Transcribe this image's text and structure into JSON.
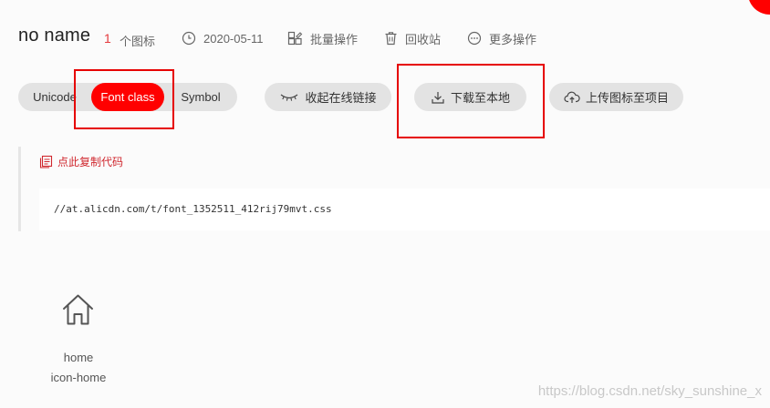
{
  "header": {
    "project_name": "no name",
    "icon_count": "1",
    "icon_count_label": "个图标",
    "date": "2020-05-11",
    "batch_label": "批量操作",
    "recycle_label": "回收站",
    "more_label": "更多操作"
  },
  "tabs": {
    "unicode": "Unicode",
    "font_class": "Font class",
    "symbol": "Symbol",
    "active": "Font class"
  },
  "actions": {
    "collapse_link": "收起在线链接",
    "download": "下载至本地",
    "upload": "上传图标至项目"
  },
  "code": {
    "copy_label": "点此复制代码",
    "url": "//at.alicdn.com/t/font_1352511_412rij79mvt.css"
  },
  "icons": [
    {
      "name": "home",
      "class_name": "icon-home",
      "icon": "home-icon"
    }
  ],
  "watermark": "https://blog.csdn.net/sky_sunshine_x",
  "colors": {
    "accent": "#ff0000",
    "highlight_box": "#e60000",
    "pill_bg": "#e3e3e3"
  }
}
